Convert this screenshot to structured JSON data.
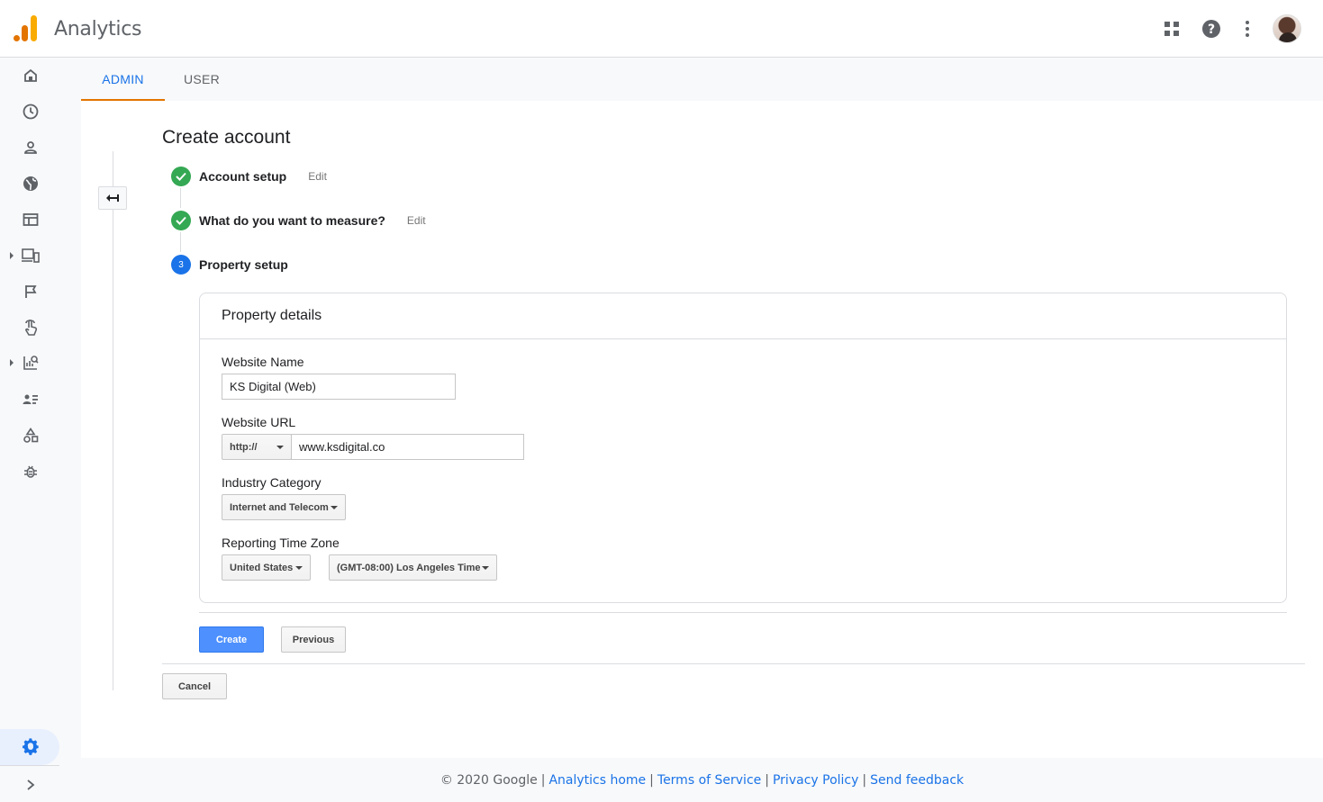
{
  "app": {
    "title": "Analytics"
  },
  "header": {
    "icons": [
      "apps-grid-icon",
      "help-icon",
      "more-vert-icon",
      "account-avatar"
    ]
  },
  "sidenav": {
    "icons": [
      "home-icon",
      "realtime-clock-icon",
      "audience-person-icon",
      "acquisition-globe-icon",
      "behavior-browser-icon",
      "devices-icon",
      "conversions-flag-icon",
      "touch-icon",
      "reports-icon",
      "users-list-icon",
      "shapes-icon",
      "debug-bug-icon",
      "settings-gear-icon",
      "expand-chevron-icon"
    ]
  },
  "tabs": [
    {
      "label": "ADMIN",
      "active": true
    },
    {
      "label": "USER",
      "active": false
    }
  ],
  "main": {
    "title": "Create account",
    "steps": [
      {
        "label": "Account setup",
        "status": "done",
        "edit": "Edit"
      },
      {
        "label": "What do you want to measure?",
        "status": "done",
        "edit": "Edit"
      },
      {
        "label": "Property setup",
        "status": "current",
        "number": "3"
      }
    ],
    "card": {
      "title": "Property details",
      "website_name": {
        "label": "Website Name",
        "value": "KS Digital (Web)"
      },
      "website_url": {
        "label": "Website URL",
        "protocol": "http://",
        "value": "www.ksdigital.co"
      },
      "industry": {
        "label": "Industry Category",
        "value": "Internet and Telecom"
      },
      "timezone": {
        "label": "Reporting Time Zone",
        "country": "United States",
        "zone": "(GMT-08:00) Los Angeles Time"
      }
    },
    "buttons": {
      "create": "Create",
      "previous": "Previous",
      "cancel": "Cancel"
    }
  },
  "footer": {
    "copyright": "© 2020 Google",
    "links": [
      "Analytics home",
      "Terms of Service",
      "Privacy Policy",
      "Send feedback"
    ]
  },
  "colors": {
    "accent_blue": "#1a73e8",
    "tab_underline_orange": "#e37400",
    "done_green": "#34a853",
    "primary_button": "#4d90fe"
  }
}
